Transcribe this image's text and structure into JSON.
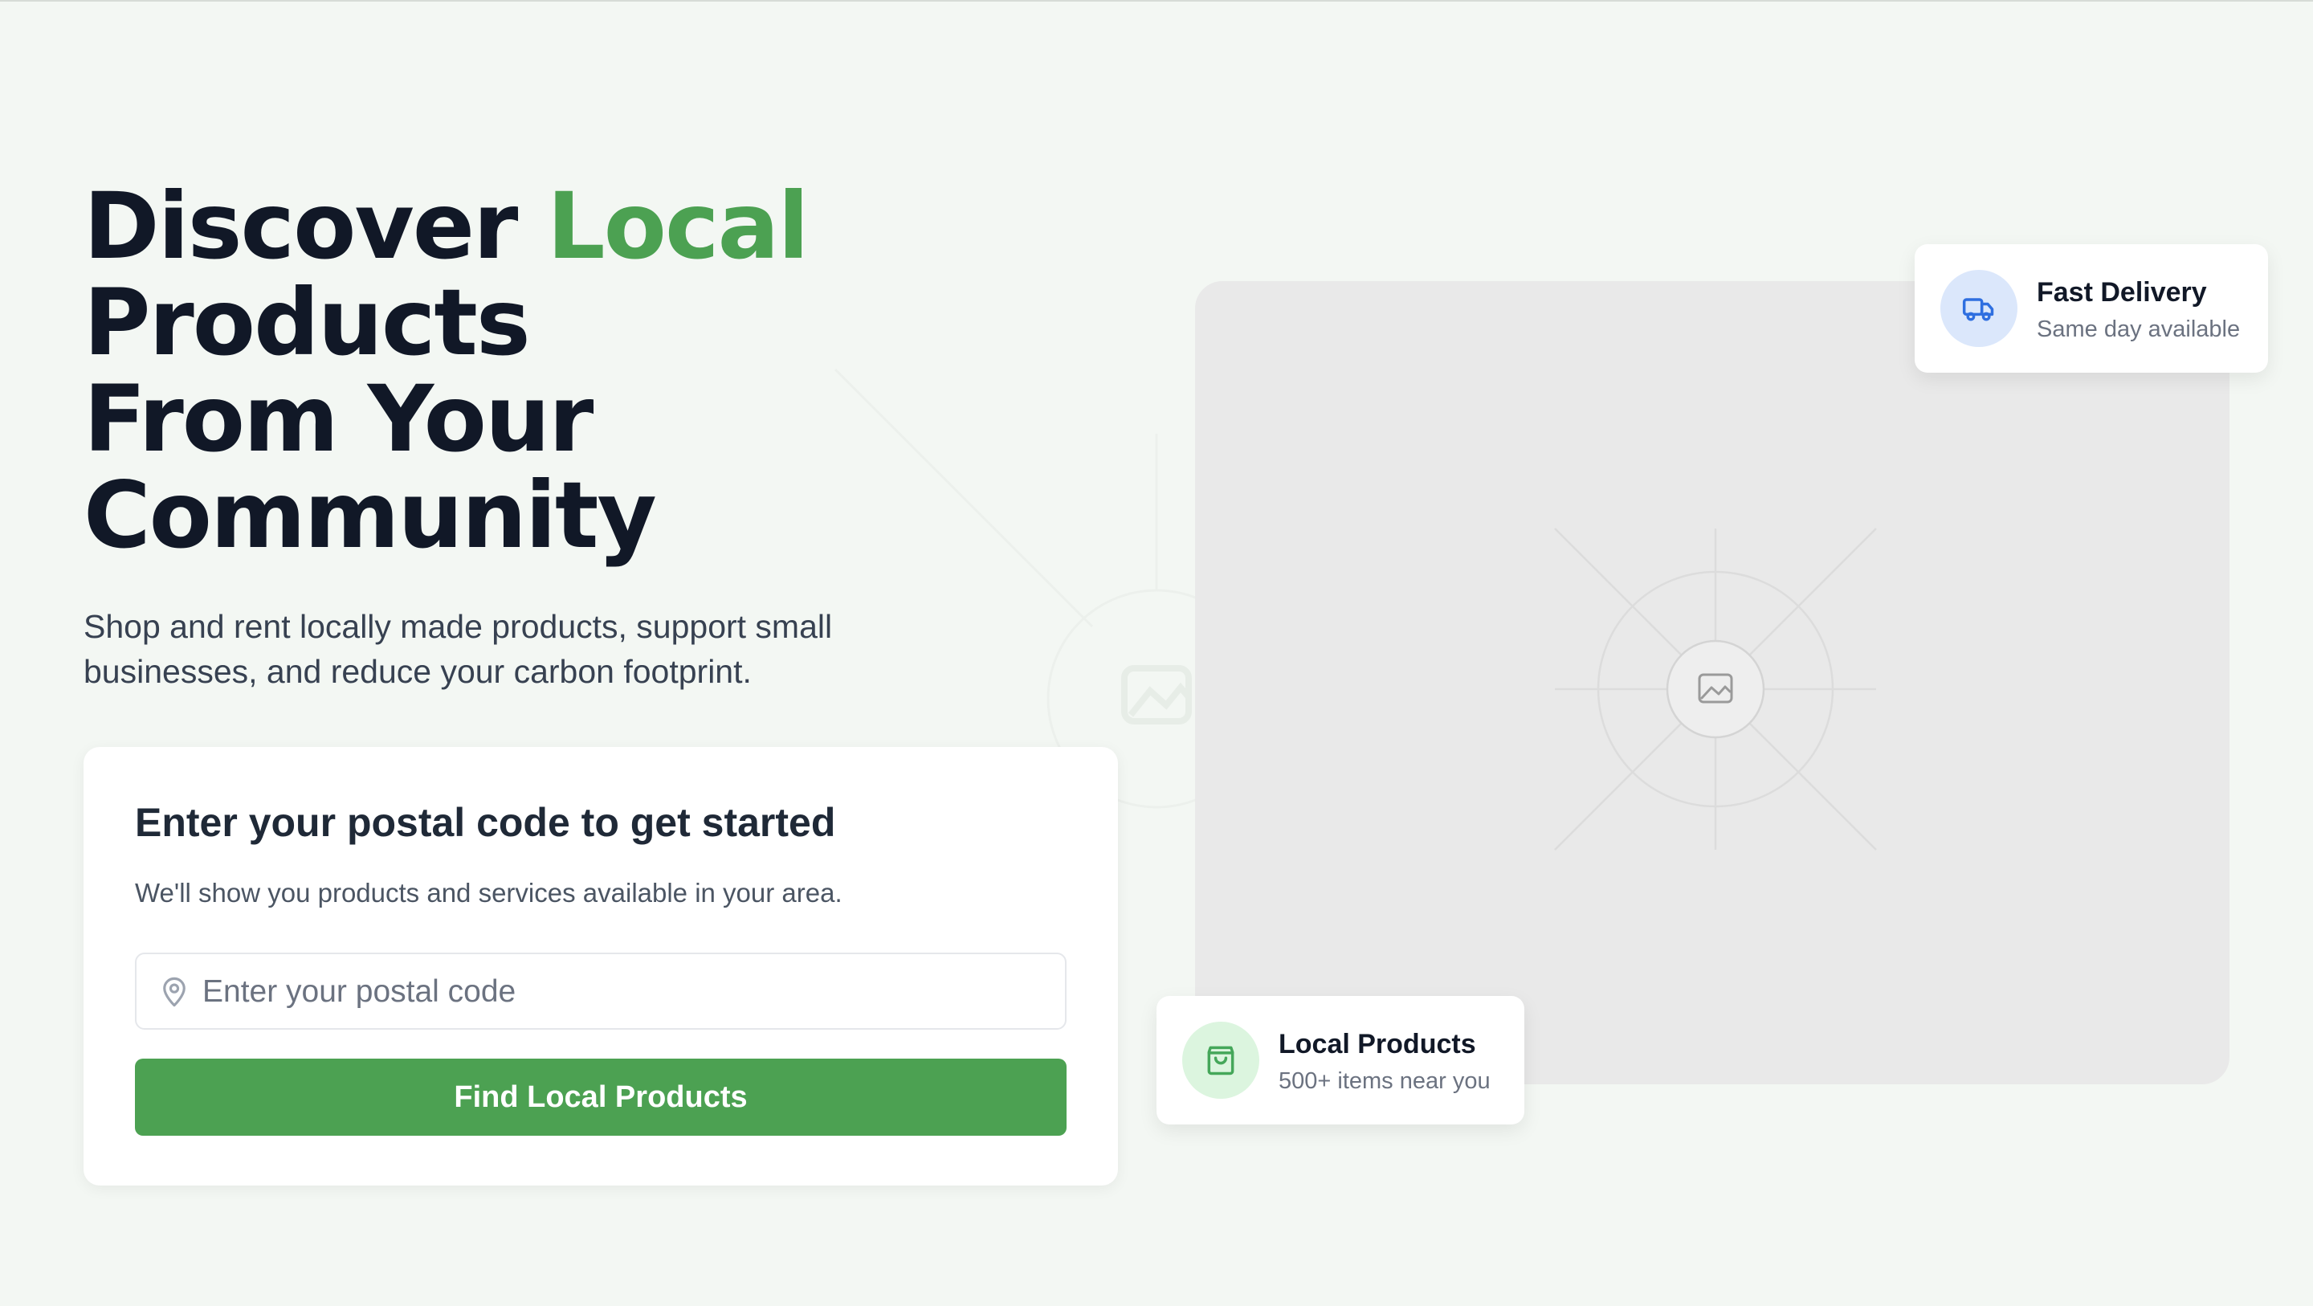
{
  "hero": {
    "headline_word_1": "Discover ",
    "headline_accent": "Local",
    "headline_line_2": "Products",
    "headline_line_3": "From Your",
    "headline_line_4": "Community",
    "subtext": "Shop and rent locally made products, support small businesses, and reduce your carbon footprint."
  },
  "postal_card": {
    "title": "Enter your postal code to get started",
    "description": "We'll show you products and services available in your area.",
    "input_placeholder": "Enter your postal code",
    "input_value": "",
    "button_label": "Find Local Products"
  },
  "image_panel": {
    "icon": "image-placeholder-icon"
  },
  "badges": {
    "delivery": {
      "icon": "truck-icon",
      "title": "Fast Delivery",
      "subtitle": "Same day available"
    },
    "local_products": {
      "icon": "shopping-bag-icon",
      "title": "Local Products",
      "subtitle": "500+ items near you"
    }
  },
  "colors": {
    "accent": "#4ca152",
    "background": "#f3f7f3",
    "heading": "#111827",
    "delivery_icon": "#2f6fe0",
    "delivery_icon_bg": "#dbe7fb",
    "products_icon": "#45a75a",
    "products_icon_bg": "#dcf5df"
  }
}
